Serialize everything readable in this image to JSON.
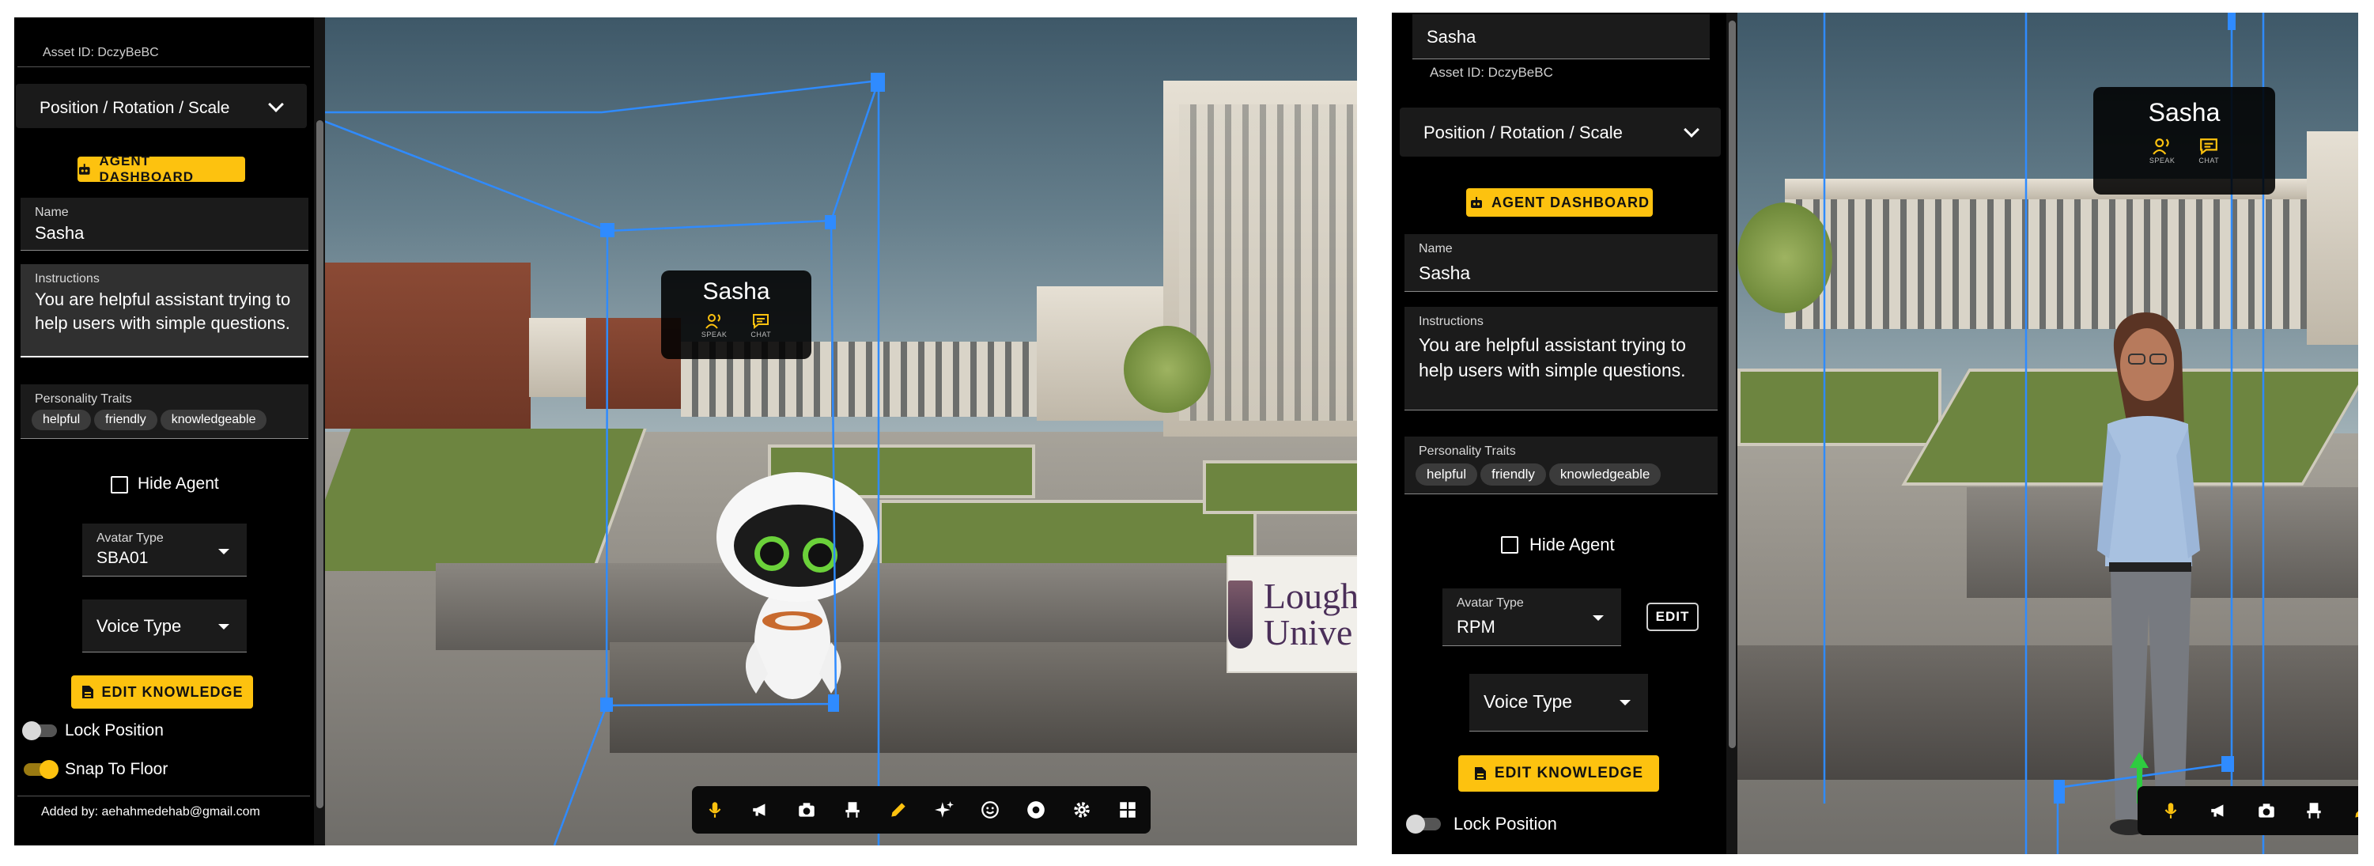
{
  "left": {
    "panel": {
      "asset_id": "Asset ID: DczyBeBC",
      "accordion_title": "Position / Rotation / Scale",
      "agent_dashboard_label": "AGENT DASHBOARD",
      "name_label": "Name",
      "name_value": "Sasha",
      "instructions_label": "Instructions",
      "instructions_value": "You are helpful assistant trying to help users with simple questions.",
      "traits_label": "Personality Traits",
      "traits": [
        "helpful",
        "friendly",
        "knowledgeable"
      ],
      "hide_agent_label": "Hide Agent",
      "avatar_type_label": "Avatar Type",
      "avatar_type_value": "SBA01",
      "voice_type_label": "Voice Type",
      "edit_knowledge_label": "EDIT KNOWLEDGE",
      "lock_position_label": "Lock Position",
      "snap_to_floor_label": "Snap To Floor",
      "added_by": "Added by: aehahmedehab@gmail.com",
      "lock_position_on": false,
      "snap_to_floor_on": true
    },
    "agent_card": {
      "name": "Sasha",
      "speak_label": "SPEAK",
      "chat_label": "CHAT"
    },
    "sign_text": "Lough\nUnive",
    "toolbar_icons": [
      "mic-icon",
      "megaphone-icon",
      "camera-icon",
      "seat-icon",
      "pencil-icon",
      "sparkles-icon",
      "emoji-icon",
      "record-icon",
      "gear-icon",
      "grid-icon"
    ]
  },
  "right": {
    "panel": {
      "name_top": "Sasha",
      "asset_id": "Asset ID: DczyBeBC",
      "accordion_title": "Position / Rotation / Scale",
      "agent_dashboard_label": "AGENT DASHBOARD",
      "name_label": "Name",
      "name_value": "Sasha",
      "instructions_label": "Instructions",
      "instructions_value": "You are helpful assistant trying to help users with simple questions.",
      "traits_label": "Personality Traits",
      "traits": [
        "helpful",
        "friendly",
        "knowledgeable"
      ],
      "hide_agent_label": "Hide Agent",
      "avatar_type_label": "Avatar Type",
      "avatar_type_value": "RPM",
      "edit_label": "EDIT",
      "voice_type_label": "Voice Type",
      "edit_knowledge_label": "EDIT KNOWLEDGE",
      "lock_position_label": "Lock Position",
      "lock_position_on": false
    },
    "agent_card": {
      "name": "Sasha",
      "speak_label": "SPEAK",
      "chat_label": "CHAT"
    },
    "toolbar_icons": [
      "mic-icon",
      "megaphone-icon",
      "camera-icon",
      "seat-icon",
      "pencil-icon"
    ]
  },
  "colors": {
    "accent": "#fdc20f",
    "panel_bg": "#000000",
    "field_bg": "#1b1b1b",
    "gizmo_blue": "#2f8bff"
  }
}
